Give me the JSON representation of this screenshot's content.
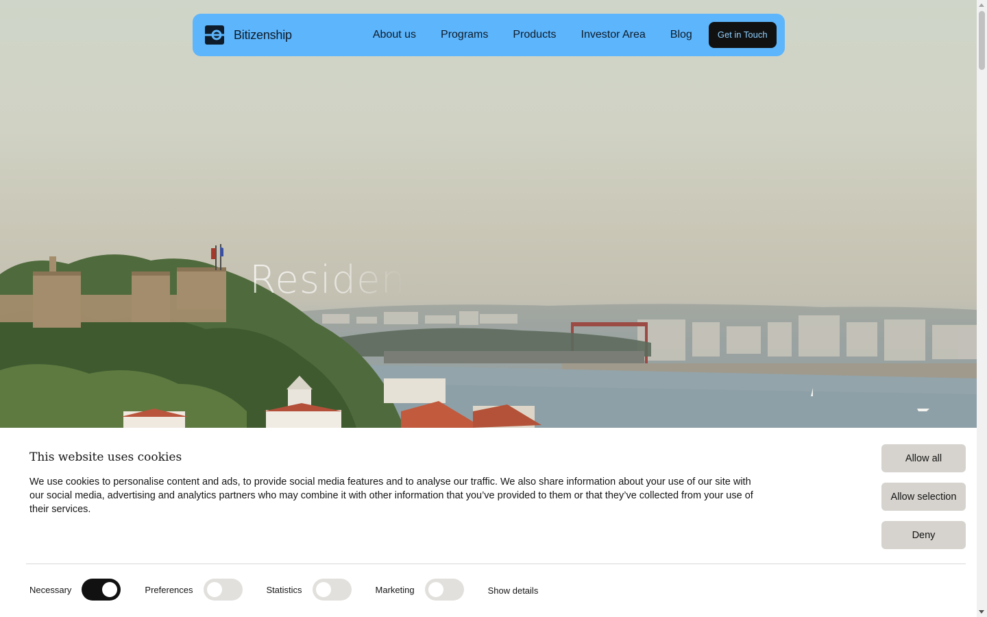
{
  "brand": {
    "name": "Bitizenship",
    "icon": "bitizenship-logo-icon",
    "nav_color": "#5db5fb"
  },
  "nav": {
    "links": [
      "About us",
      "Programs",
      "Products",
      "Investor Area",
      "Blog"
    ],
    "cta": "Get in Touch"
  },
  "hero": {
    "headline_partial": "Residen"
  },
  "cookie": {
    "title": "This website uses cookies",
    "body": "We use cookies to personalise content and ads, to provide social media features and to analyse our traffic. We also share information about your use of our site with our social media, advertising and analytics partners who may combine it with other information that you’ve provided to them or that they’ve collected from your use of their services.",
    "buttons": {
      "allow_all": "Allow all",
      "allow_selection": "Allow selection",
      "deny": "Deny"
    },
    "toggles": [
      {
        "label": "Necessary",
        "on": true
      },
      {
        "label": "Preferences",
        "on": false
      },
      {
        "label": "Statistics",
        "on": false
      },
      {
        "label": "Marketing",
        "on": false
      }
    ],
    "show_details": "Show details"
  }
}
